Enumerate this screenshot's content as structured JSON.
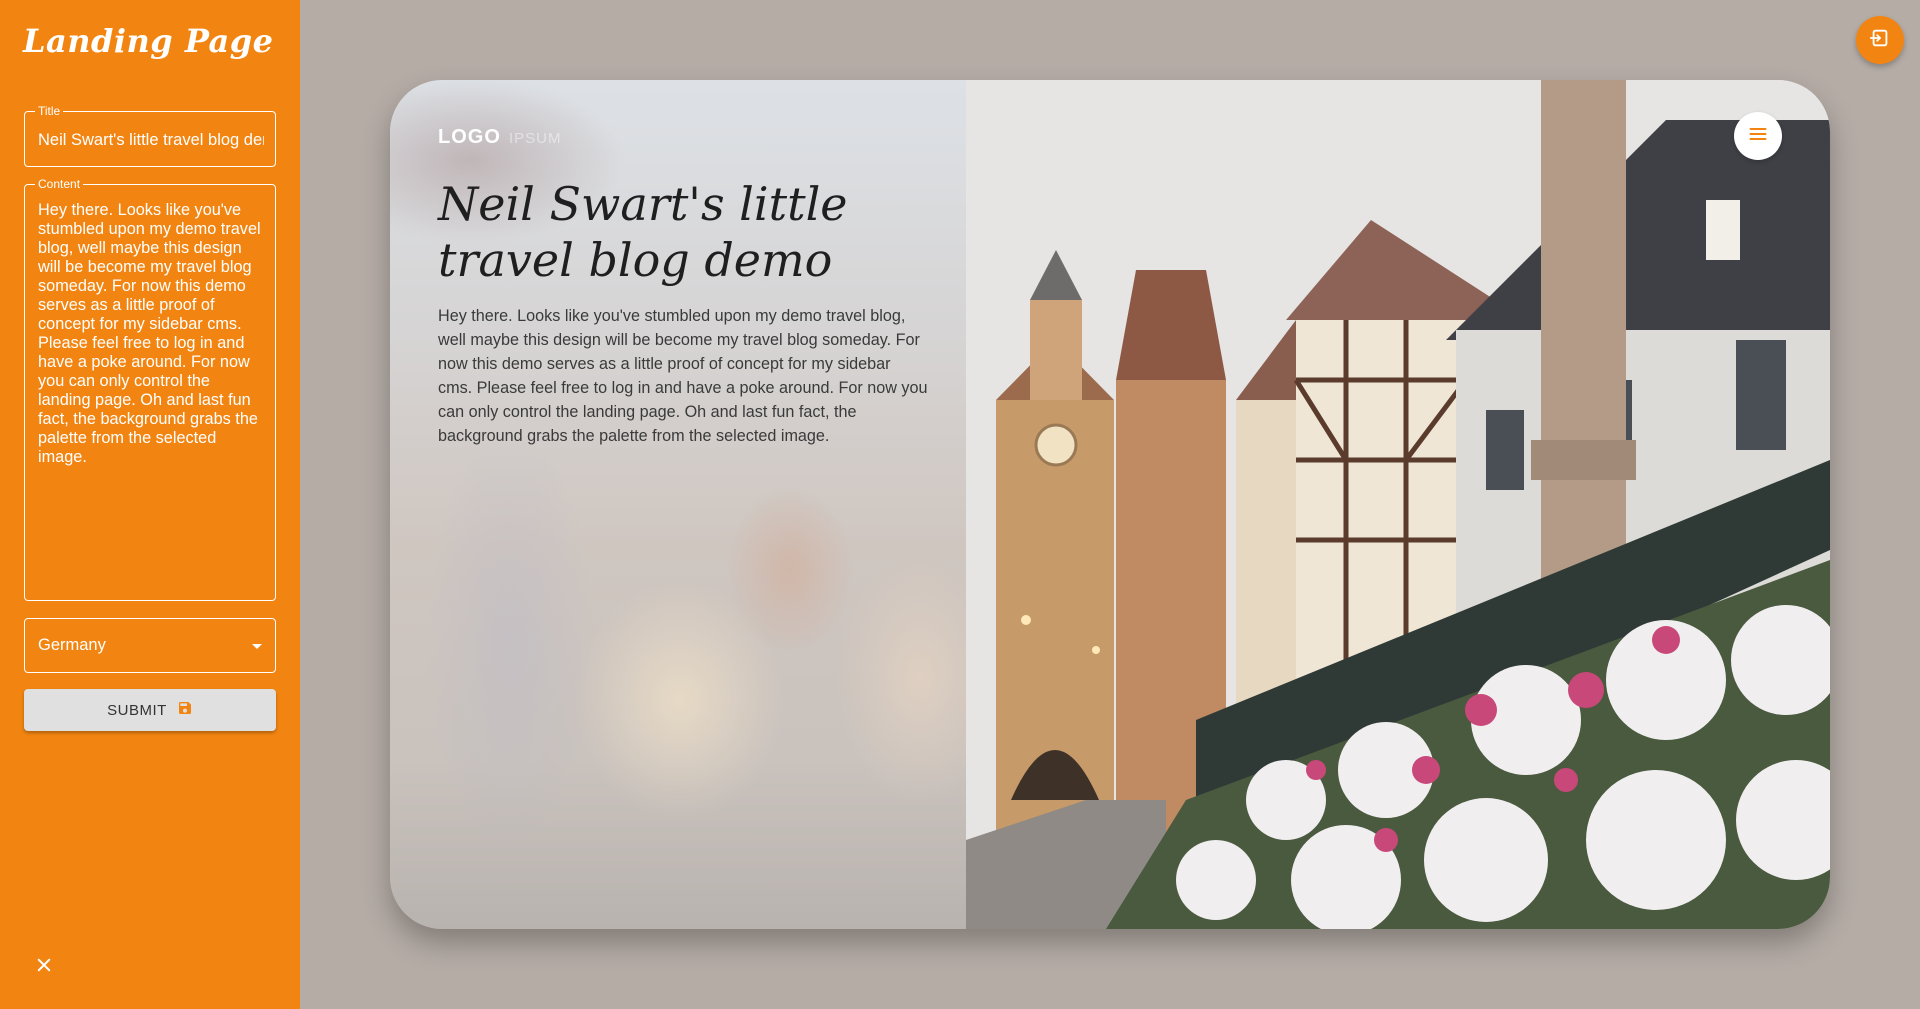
{
  "sidebar": {
    "title": "Landing Page",
    "title_field": {
      "legend": "Title",
      "value": "Neil Swart's little travel blog demo"
    },
    "content_field": {
      "legend": "Content",
      "value": "Hey there. Looks like you've stumbled upon my demo travel blog, well maybe this design will be become my travel blog someday. For now this demo serves as a little proof of concept for my sidebar cms. Please feel free to log in and have a poke around. For now you can only control the landing page. Oh and last fun fact, the background grabs the palette from the selected image."
    },
    "country_select": {
      "selected": "Germany"
    },
    "submit_label": "SUBMIT",
    "close_icon": "close-icon"
  },
  "logout_icon": "logout-icon",
  "card": {
    "logo": "LOGO",
    "logo_suffix": "IPSUM",
    "title": "Neil Swart's little travel blog demo",
    "body": "Hey there. Looks like you've stumbled upon my demo travel blog, well maybe this design will be become my travel blog someday. For now this demo serves as a little proof of concept for my sidebar cms. Please feel free to log in and have a poke around. For now you can only control the landing page. Oh and last fun fact, the background grabs the palette from the selected image.",
    "menu_icon": "menu-icon"
  },
  "colors": {
    "accent": "#f28511",
    "background": "#b5aca6",
    "button_grey": "#e0e0e0"
  }
}
